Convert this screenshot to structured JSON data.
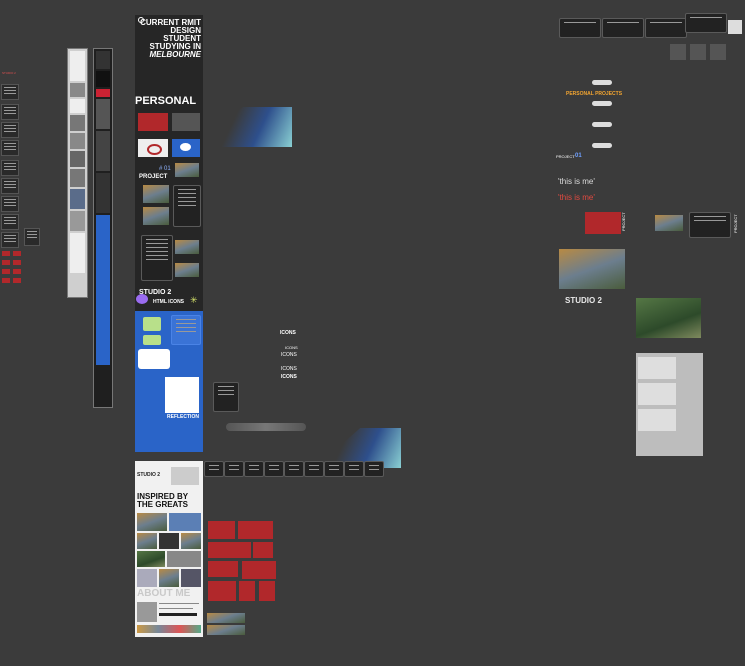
{
  "canvas": {
    "background": "#3b3b3b"
  },
  "colors": {
    "accent_blue": "#2a64c8",
    "accent_red": "#b1282b",
    "accent_orange": "#f2a531",
    "dark_panel": "#262626"
  },
  "main_board": {
    "title": "CURRENT RMIT DESIGN STUDENT STUDYING IN",
    "city": "MELBOURNE",
    "section_personal": "PERSONAL",
    "project_label": "PROJECT",
    "project_number": "# 01",
    "studio_title": "STUDIO 2",
    "html_icons": "HTML ICONS",
    "reflection": "REFLECTION"
  },
  "icons_labels": [
    "ICONS",
    "ICONS",
    "ICONS",
    "ICONS",
    "ICONS"
  ],
  "lower_board": {
    "studio": "STUDIO 2",
    "inspired": "INSPIRED BY THE GREATS",
    "about": "ABOUT ME"
  },
  "right_area": {
    "personal_projects": "PERSONAL PROJECTS",
    "project_tag": "PROJECT",
    "project_num": "01",
    "this_is_me_1": "'this is me'",
    "this_is_me_2": "'this is me'",
    "studio2": "STUDIO 2",
    "project_vertical_1": "PROJECT",
    "project_vertical_2": "PROJECT"
  },
  "left_area": {
    "red_label": "STUDIO 2"
  }
}
